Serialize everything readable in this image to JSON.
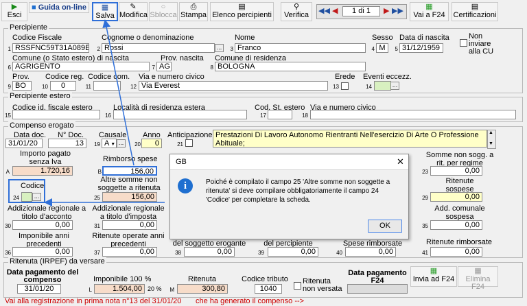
{
  "toolbar": {
    "esci": "Esci",
    "guida": "Guida on-line",
    "salva": "Salva",
    "modifica": "Modifica",
    "sblocca": "Sblocca",
    "stampa": "Stampa",
    "elenco": "Elenco percipienti",
    "verifica": "Verifica",
    "record_counter": "1 di 1",
    "vai_f24": "Vai a F24",
    "certificazioni": "Certificazioni"
  },
  "percipiente": {
    "section": "Percipiente",
    "codice_fiscale_label": "Codice Fiscale",
    "codice_fiscale": "RSSFNC59T31A089E",
    "cognome_label": "Cognome o denominazione",
    "cognome": "Rossi",
    "nome_label": "Nome",
    "nome": "Franco",
    "sesso_label": "Sesso",
    "sesso": "M",
    "data_nascita_label": "Data di nascita",
    "data_nascita": "31/12/1959",
    "non_inviare_label": "Non inviare alla CU",
    "comune_nascita_label": "Comune (o Stato estero) di nascita",
    "comune_nascita": "AGRIGENTO",
    "prov_nascita_label": "Prov. nascita",
    "prov_nascita": "AG",
    "comune_residenza_label": "Comune di residenza",
    "comune_residenza": "BOLOGNA",
    "prov_label": "Prov.",
    "prov": "BO",
    "codice_reg_label": "Codice reg.",
    "codice_reg": "0",
    "codice_com_label": "Codice com.",
    "codice_com": "",
    "via_label": "Via e numero civico",
    "via": "Via Everest",
    "erede_label": "Erede",
    "eventi_label": "Eventi eccezz."
  },
  "estero": {
    "section": "Percipiente estero",
    "cod_fiscale_label": "Codice id. fiscale estero",
    "localita_label": "Località di residenza estera",
    "cod_stato_label": "Cod. St. estero",
    "via_label": "Via e numero civico"
  },
  "compenso": {
    "section": "Compenso erogato",
    "data_doc_label": "Data doc.",
    "data_doc": "31/01/20",
    "n_doc_label": "N° Doc.",
    "n_doc": "13",
    "causale_label": "Causale",
    "causale": "A",
    "anno_label": "Anno",
    "anno": "0",
    "anticipazione_label": "Anticipazione",
    "descrizione": "Prestazioni Di Lavoro Autonomo Rientranti Nell'esercizio Di Arte O Professione Abituale;",
    "importo_label": "Importo pagato senza Iva",
    "importo": "1.720,16",
    "rimborso_label": "Rimborso spese",
    "rimborso": "156,00",
    "altre_label": "Altre somme non soggette a ritenuta",
    "altre": "156,00",
    "codice_label": "Codice",
    "somme_regime_label": "Somme non sogg. a rit. per regime convenz.",
    "somme_regime": "0,00",
    "ritenute_sospese_label": "Ritenute sospese",
    "ritenute_sospese": "0,00",
    "add_reg_acconto_label": "Addizionale regionale a titolo d'acconto",
    "add_reg_acconto": "0,00",
    "add_reg_imposta_label": "Addizionale regionale a titolo d'imposta",
    "add_reg_imposta": "0,00",
    "add_com_sospesa_label": "Add. comunale sospesa",
    "add_com_sospesa": "0,00",
    "imponibili_prec_label": "Imponibile anni precedenti",
    "imponibili_prec": "0,00",
    "ritenute_prec_label": "Ritenute operate anni precedenti",
    "ritenute_prec": "0,00",
    "soggetto_erogante_label": "del soggetto erogante",
    "soggetto_erogante": "0,00",
    "del_percipiente_label": "del percipiente",
    "del_percipiente": "0,00",
    "spese_rimborsate_label": "Spese rimborsate",
    "spese_rimborsate": "0,00",
    "ritenute_rimborsate_label": "Ritenute rimborsate",
    "ritenute_rimborsate": "0,00"
  },
  "ritenuta": {
    "section": "Ritenuta (IRPEF) da versare",
    "data_pagamento_label": "Data pagamento del compenso",
    "data_pagamento": "31/01/20",
    "imponibile_label": "Imponibile 100 %",
    "imponibile": "1.504,00",
    "perc": "20 %",
    "ritenuta_label": "Ritenuta",
    "ritenuta": "300,80",
    "codice_tributo_label": "Codice tributo",
    "codice_tributo": "1040",
    "non_versata_label": "Ritenuta non versata",
    "data_f24_label": "Data pagamento F24",
    "invia_f24": "Invia ad F24",
    "elimina_f24": "Elimina F24"
  },
  "status": {
    "left": "Vai alla registrazione in prima nota n°13 del 31/01/20",
    "right": "che ha generato il compenso -->"
  },
  "dialog": {
    "title": "GB",
    "message": "Poiché è compilato il campo 25 'Altre somme non soggette a ritenuta' si deve compilare obbligatoriamente il campo 24 'Codice' per completare la scheda.",
    "ok": "OK"
  },
  "colors": {
    "accent": "#2f6fd8",
    "status_text": "#cc0000",
    "green_icon": "#2a9d2a"
  }
}
